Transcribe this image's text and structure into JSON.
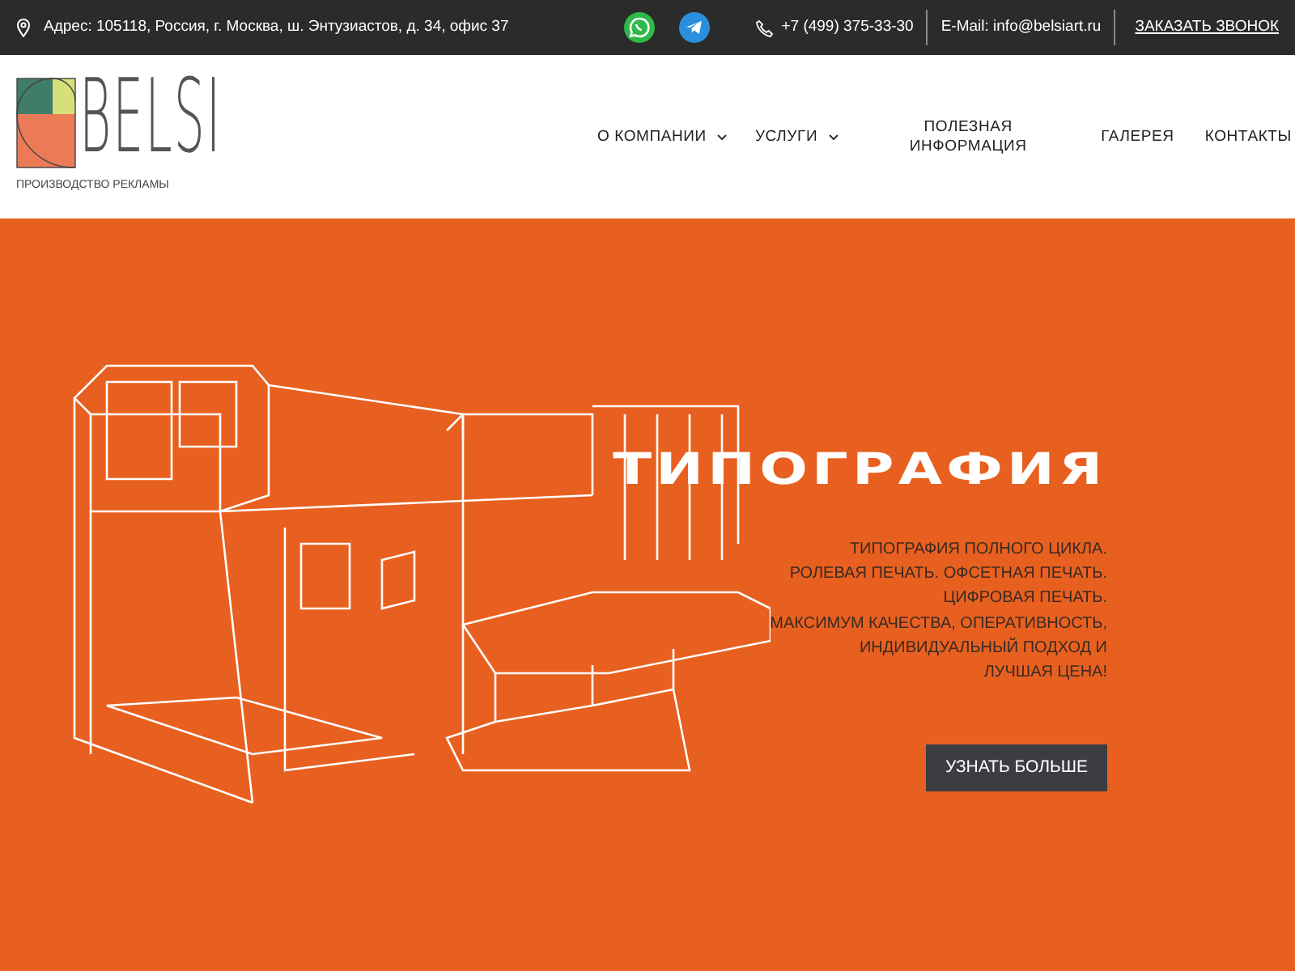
{
  "top_bar": {
    "address": "Адрес: 105118, Россия, г. Москва, ш. Энтузиастов, д. 34, офис 37",
    "phone": "+7 (499) 375-33-30",
    "email": "E-Mail: info@belsiart.ru",
    "callback": "ЗАКАЗАТЬ ЗВОНОК"
  },
  "logo": {
    "text": "BELSI",
    "tagline": "ПРОИЗВОДСТВО РЕКЛАМЫ"
  },
  "nav": [
    {
      "label": "О КОМПАНИИ",
      "has_dropdown": true
    },
    {
      "label": "УСЛУГИ",
      "has_dropdown": true
    },
    {
      "label": "ПОЛЕЗНАЯ ИНФОРМАЦИЯ",
      "has_dropdown": false
    },
    {
      "label": "ГАЛЕРЕЯ",
      "has_dropdown": false
    },
    {
      "label": "КОНТАКТЫ",
      "has_dropdown": false
    }
  ],
  "hero": {
    "title": "ТИПОГРАФИЯ",
    "description": [
      "ТИПОГРАФИЯ ПОЛНОГО ЦИКЛА.",
      "РОЛЕВАЯ ПЕЧАТЬ. ОФСЕТНАЯ ПЕЧАТЬ.",
      "ЦИФРОВАЯ ПЕЧАТЬ.",
      "МАКСИМУМ КАЧЕСТВА, ОПЕРАТИВНОСТЬ,",
      "ИНДИВИДУАЛЬНЫЙ ПОДХОД И",
      "ЛУЧШАЯ ЦЕНА!"
    ],
    "button": "УЗНАТЬ БОЛЬШЕ"
  }
}
